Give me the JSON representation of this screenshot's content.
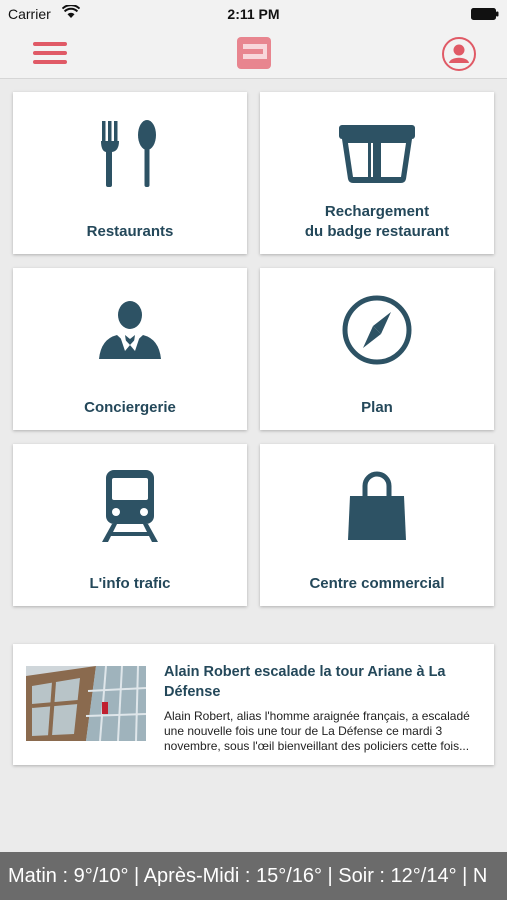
{
  "status_bar": {
    "carrier": "Carrier",
    "time": "2:11 PM"
  },
  "nav": {
    "menu_icon": "hamburger-icon",
    "logo_icon": "app-logo",
    "profile_icon": "user-icon"
  },
  "theme": {
    "accent": "#e05a66",
    "tile_text": "#24485a",
    "icon_color": "#2d5264"
  },
  "tiles": [
    {
      "label": "Restaurants",
      "icon": "fork-spoon-icon"
    },
    {
      "label": "Rechargement\ndu badge restaurant",
      "icon": "badge-card-icon"
    },
    {
      "label": "Conciergerie",
      "icon": "concierge-person-icon"
    },
    {
      "label": "Plan",
      "icon": "compass-icon"
    },
    {
      "label": "L'info trafic",
      "icon": "train-icon"
    },
    {
      "label": "Centre commercial",
      "icon": "shopping-bag-icon"
    }
  ],
  "news": {
    "title": "Alain Robert escalade la tour Ariane à La Défense",
    "excerpt": "Alain Robert, alias l'homme araignée français, a escaladé une nouvelle fois une tour de La Défense ce mardi 3 novembre, sous l'œil bienveillant des policiers cette fois..."
  },
  "weather": {
    "text": "Matin : 9°/10° | Après-Midi : 15°/16° | Soir : 12°/14° | N"
  }
}
